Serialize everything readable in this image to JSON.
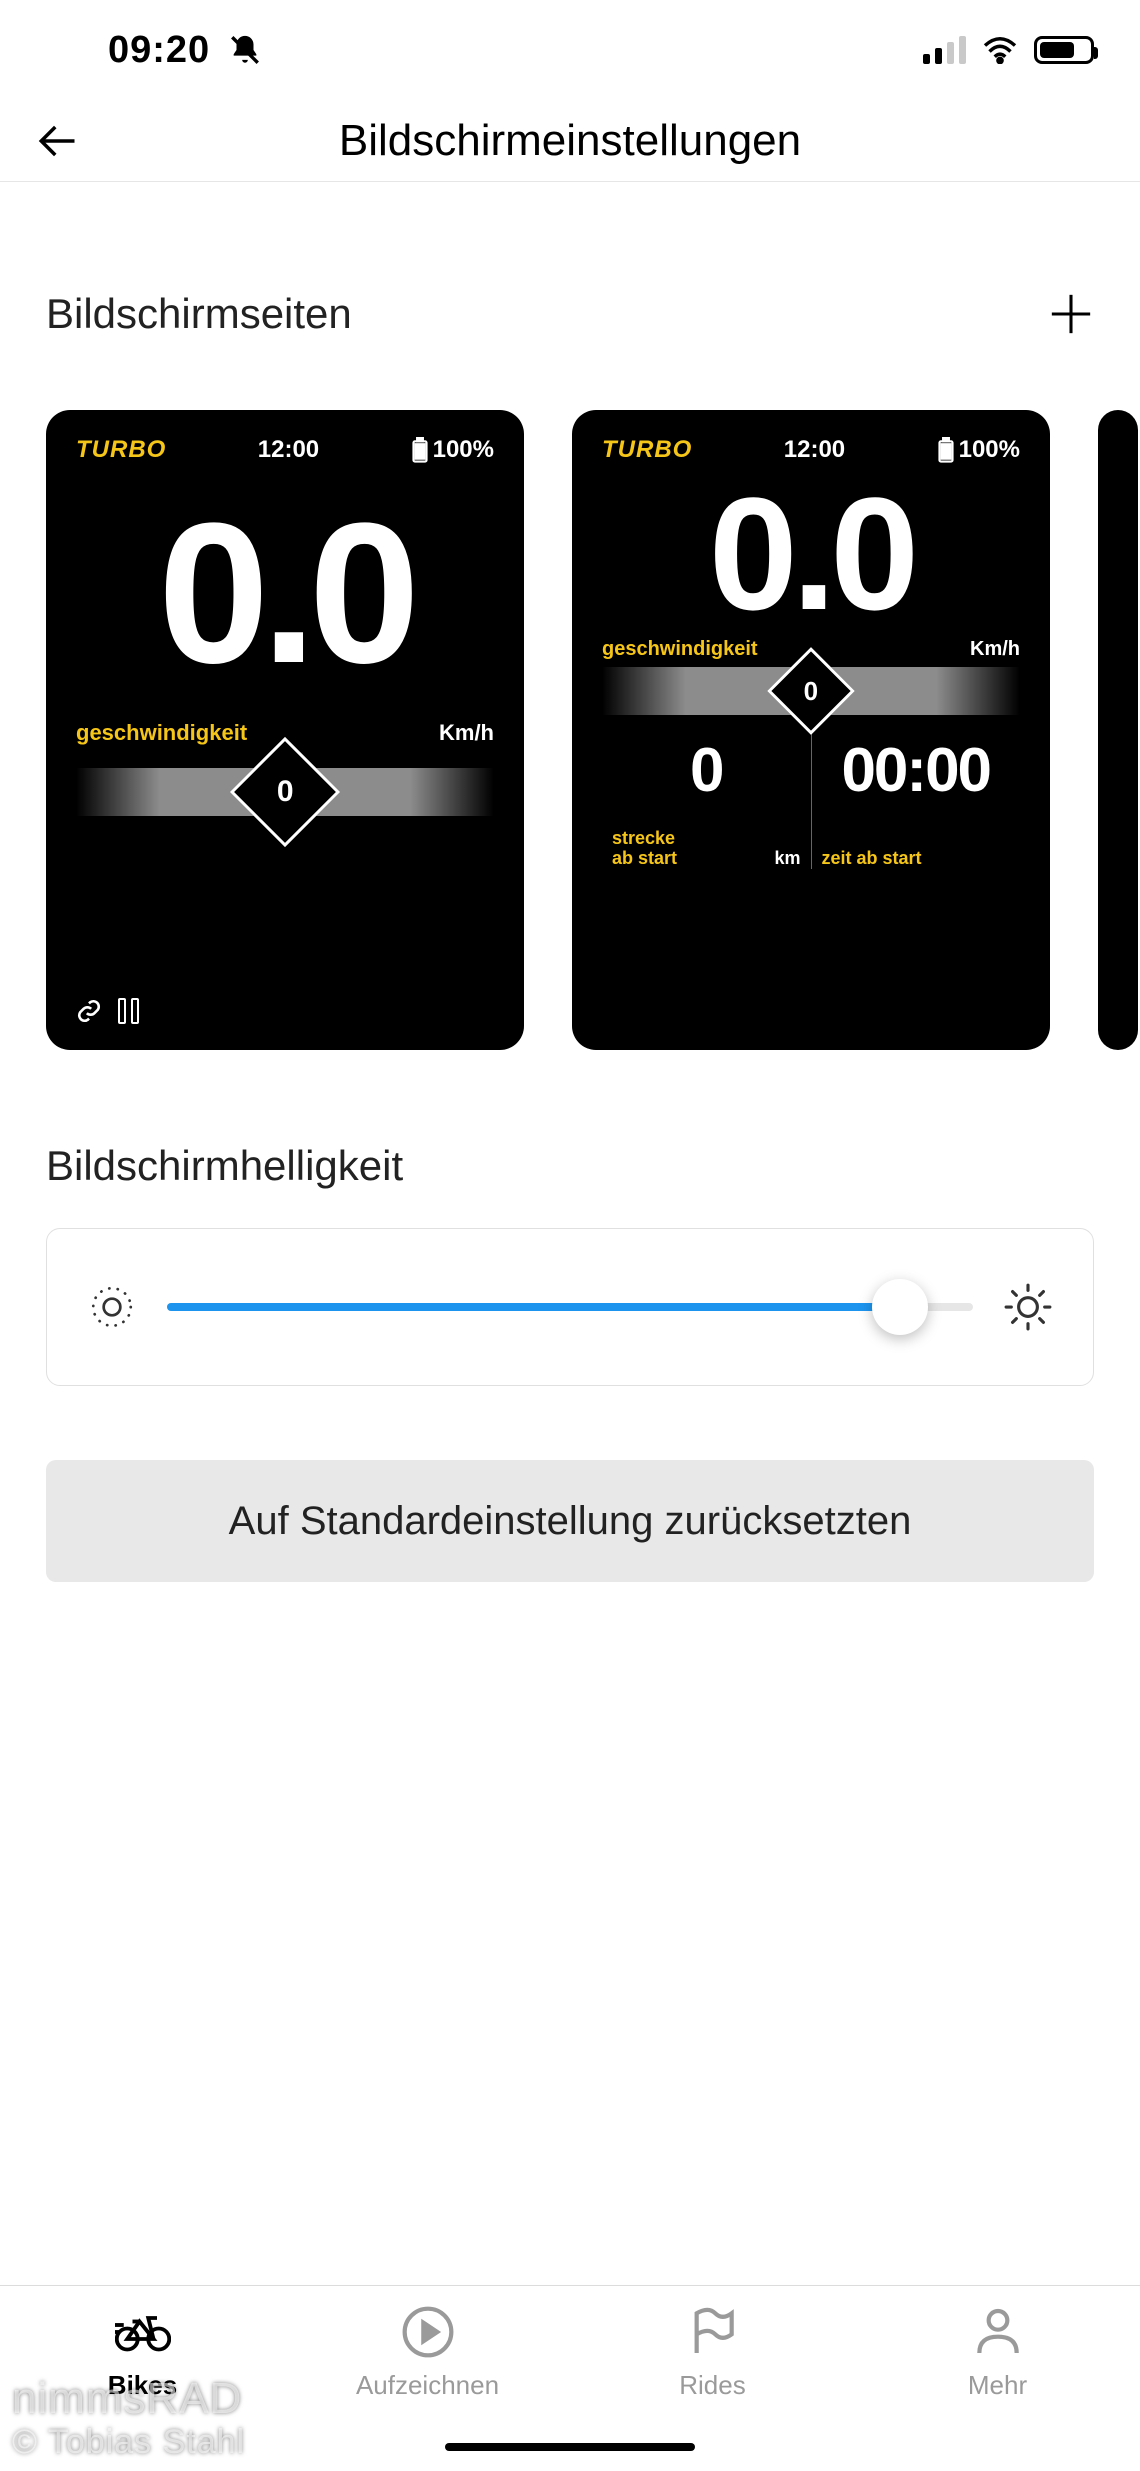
{
  "status": {
    "time": "09:20",
    "battery_pct": 70
  },
  "header": {
    "title": "Bildschirmeinstellungen"
  },
  "pages": {
    "title": "Bildschirmseiten",
    "cards": [
      {
        "mode": "TURBO",
        "clock": "12:00",
        "battery": "100%",
        "speed": "0.0",
        "speed_label": "geschwindigkeit",
        "speed_unit": "Km/h",
        "gauge_value": "0"
      },
      {
        "mode": "TURBO",
        "clock": "12:00",
        "battery": "100%",
        "speed": "0.0",
        "speed_label": "geschwindigkeit",
        "speed_unit": "Km/h",
        "gauge_value": "0",
        "left_val": "0",
        "left_lab_l1": "strecke",
        "left_lab_l2": "ab start",
        "left_unit": "km",
        "right_val": "00:00",
        "right_lab": "zeit ab start"
      }
    ]
  },
  "brightness": {
    "title": "Bildschirmhelligkeit",
    "value_pct": 91
  },
  "reset": {
    "label": "Auf Standardeinstellung zurücksetzten"
  },
  "tabs": {
    "bikes": "Bikes",
    "record": "Aufzeichnen",
    "rides": "Rides",
    "more": "Mehr"
  },
  "watermark": {
    "l1": "nimmsRAD",
    "l2": "© Tobias Stahl"
  }
}
